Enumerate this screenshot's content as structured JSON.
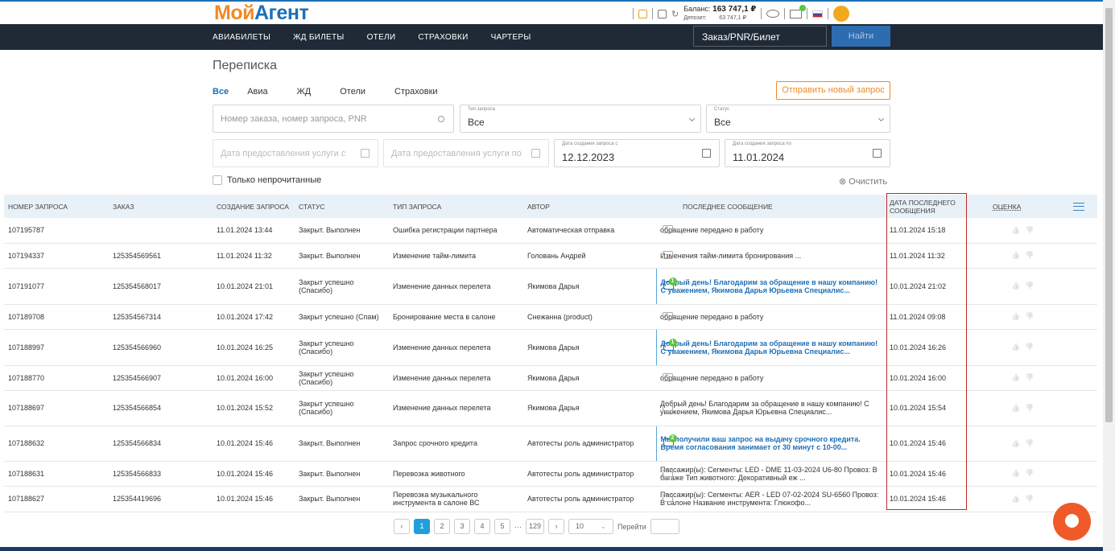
{
  "header": {
    "logo_part1": "Мой",
    "logo_part2": "Агент",
    "balance_label": "Баланс:",
    "balance_value": "163 747,1 ₽",
    "deposit_label": "Депозит:",
    "deposit_value": "63 747,1 ₽"
  },
  "nav": {
    "items": [
      "АВИАБИЛЕТЫ",
      "ЖД БИЛЕТЫ",
      "ОТЕЛИ",
      "СТРАХОВКИ",
      "ЧАРТЕРЫ"
    ],
    "search_value": "Заказ/PNR/Билет",
    "search_button": "Найти"
  },
  "page": {
    "title": "Переписка",
    "tabs": [
      "Все",
      "Авиа",
      "ЖД",
      "Отели",
      "Страховки"
    ],
    "send_button": "Отправить новый запрос"
  },
  "filters": {
    "search_placeholder": "Номер заказа, номер запроса, PNR",
    "type_label": "Тип запроса",
    "type_value": "Все",
    "status_label": "Статус",
    "status_value": "Все",
    "service_from_placeholder": "Дата предоставления услуги с",
    "service_to_placeholder": "Дата предоставления услуги по",
    "created_from_label": "Дата создания запроса с",
    "created_from_value": "12.12.2023",
    "created_to_label": "Дата создания запроса по",
    "created_to_value": "11.01.2024",
    "unread_only": "Только непрочитанные",
    "clear": "⊗ Очистить"
  },
  "table": {
    "columns": [
      "НОМЕР ЗАПРОСА",
      "ЗАКАЗ",
      "СОЗДАНИЕ ЗАПРОСА",
      "СТАТУС",
      "ТИП ЗАПРОСА",
      "АВТОР",
      "ПОСЛЕДНЕЕ СООБЩЕНИЕ",
      "ДАТА ПОСЛЕДНЕГО СООБЩЕНИЯ",
      "ОЦЕНКА"
    ],
    "rows": [
      {
        "id": "107195787",
        "order": "",
        "created": "11.01.2024 13:44",
        "status": "Закрыт. Выполнен",
        "type": "Ошибка регистрации партнера",
        "author": "Автоматическая отправка",
        "message": "обращение передано в работу",
        "last_date": "11.01.2024 15:18",
        "unread": false
      },
      {
        "id": "107194337",
        "order": "125354569561",
        "created": "11.01.2024 11:32",
        "status": "Закрыт. Выполнен",
        "type": "Изменение тайм-лимита",
        "author": "Головань Андрей",
        "message": "Изменения тайм-лимита бронирования ...",
        "last_date": "11.01.2024 11:32",
        "unread": false
      },
      {
        "id": "107191077",
        "order": "125354568017",
        "created": "10.01.2024 21:01",
        "status": "Закрыт успешно (Спасибо)",
        "type": "Изменение данных перелета",
        "author": "Якимова Дарья",
        "message": "Добрый день! Благодарим за обращение в нашу компанию! С уважением, Якимова Дарья Юрьевна Специалис...",
        "last_date": "10.01.2024 21:02",
        "unread": true,
        "badge": "1"
      },
      {
        "id": "107189708",
        "order": "125354567314",
        "created": "10.01.2024 17:42",
        "status": "Закрыт успешно (Спам)",
        "type": "Бронирование места в салоне",
        "author": "Снежанна (product)",
        "message": "обращение передано в работу",
        "last_date": "11.01.2024 09:08",
        "unread": false
      },
      {
        "id": "107188997",
        "order": "125354566960",
        "created": "10.01.2024 16:25",
        "status": "Закрыт успешно (Спасибо)",
        "type": "Изменение данных перелета",
        "author": "Якимова Дарья",
        "message": "Добрый день! Благодарим за обращение в нашу компанию! С уважением, Якимова Дарья Юрьевна Специалис...",
        "last_date": "10.01.2024 16:26",
        "unread": true,
        "badge": "1"
      },
      {
        "id": "107188770",
        "order": "125354566907",
        "created": "10.01.2024 16:00",
        "status": "Закрыт успешно (Спасибо)",
        "type": "Изменение данных перелета",
        "author": "Якимова Дарья",
        "message": "обращение передано в работу",
        "last_date": "10.01.2024 16:00",
        "unread": false
      },
      {
        "id": "107188697",
        "order": "125354566854",
        "created": "10.01.2024 15:52",
        "status": "Закрыт успешно (Спасибо)",
        "type": "Изменение данных перелета",
        "author": "Якимова Дарья",
        "message": "Добрый день! Благодарим за обращение в нашу компанию! С уважением, Якимова Дарья Юрьевна Специалис...",
        "last_date": "10.01.2024 15:54",
        "unread": false
      },
      {
        "id": "107188632",
        "order": "125354566834",
        "created": "10.01.2024 15:46",
        "status": "Закрыт. Выполнен",
        "type": "Запрос срочного кредита",
        "author": "Автотесты роль администратор",
        "message": "Мы получили ваш запрос на выдачу срочного кредита. Время согласования занимает от 30 минут с 10-00...",
        "last_date": "10.01.2024 15:46",
        "unread": true,
        "badge": "2"
      },
      {
        "id": "107188631",
        "order": "125354566833",
        "created": "10.01.2024 15:46",
        "status": "Закрыт. Выполнен",
        "type": "Перевозка животного",
        "author": "Автотесты роль администратор",
        "message": "Пассажир(ы): Сегменты: LED - DME 11-03-2024 U6-80 Провоз: В багаже Тип животного: Декоративный еж ...",
        "last_date": "10.01.2024 15:46",
        "unread": false
      },
      {
        "id": "107188627",
        "order": "125354419696",
        "created": "10.01.2024 15:46",
        "status": "Закрыт. Выполнен",
        "type": "Перевозка музыкального инструмента в салоне ВС",
        "author": "Автотесты роль администратор",
        "message": "Пассажир(ы): Сегменты: AER - LED 07-02-2024 SU-6560 Провоз: В салоне Название инструмента: Глюкофо...",
        "last_date": "10.01.2024 15:46",
        "unread": false
      }
    ]
  },
  "pagination": {
    "pages": [
      "1",
      "2",
      "3",
      "4",
      "5"
    ],
    "ellipsis": "···",
    "last": "129",
    "per_page": "10",
    "goto_label": "Перейти"
  }
}
